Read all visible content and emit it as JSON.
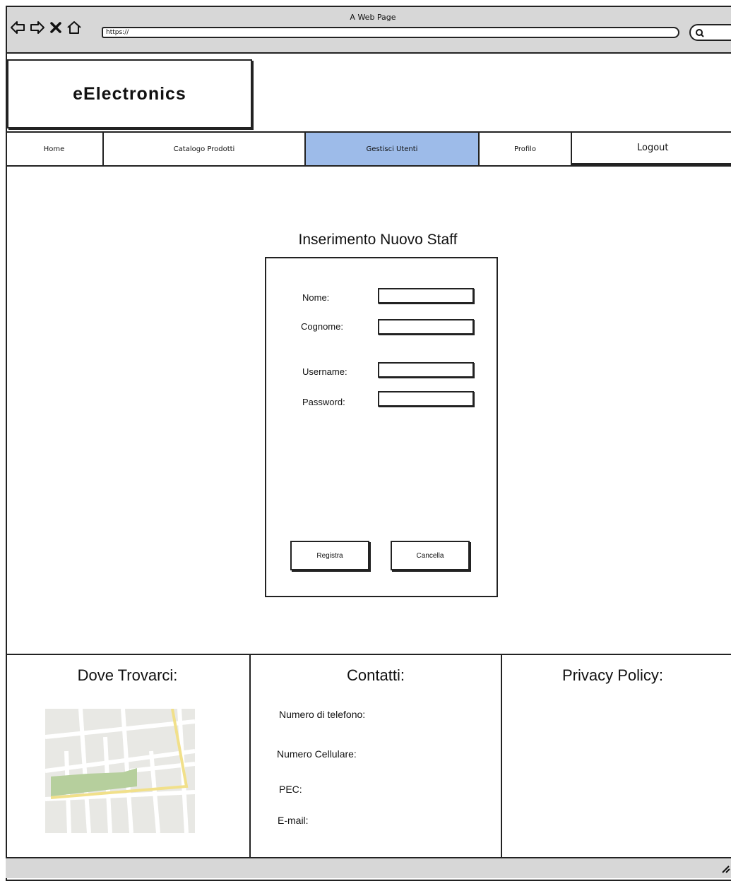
{
  "browser": {
    "window_title": "A Web Page",
    "url": "https://"
  },
  "site": {
    "logo_text": "eElectronics"
  },
  "nav": {
    "items": [
      {
        "label": "Home"
      },
      {
        "label": "Catalogo Prodotti"
      },
      {
        "label": "Gestisci Utenti",
        "active": true
      },
      {
        "label": "Profilo"
      },
      {
        "label": "Logout"
      }
    ],
    "active_color": "#9dbbe9"
  },
  "form": {
    "title": "Inserimento Nuovo Staff",
    "fields": [
      {
        "label": "Nome:",
        "value": ""
      },
      {
        "label": "Cognome:",
        "value": ""
      },
      {
        "label": "Username:",
        "value": ""
      },
      {
        "label": "Password:",
        "value": ""
      }
    ],
    "submit_label": "Registra",
    "cancel_label": "Cancella"
  },
  "footer": {
    "location_heading": "Dove Trovarci:",
    "contacts_heading": "Contatti:",
    "contacts": [
      "Numero di telefono:",
      "Numero Cellulare:",
      "PEC:",
      "E-mail:"
    ],
    "privacy_heading": "Privacy Policy:"
  },
  "icons": {
    "back": "back-arrow-icon",
    "forward": "forward-arrow-icon",
    "stop": "close-icon",
    "home": "home-icon",
    "search": "search-icon",
    "map": "map-icon"
  }
}
